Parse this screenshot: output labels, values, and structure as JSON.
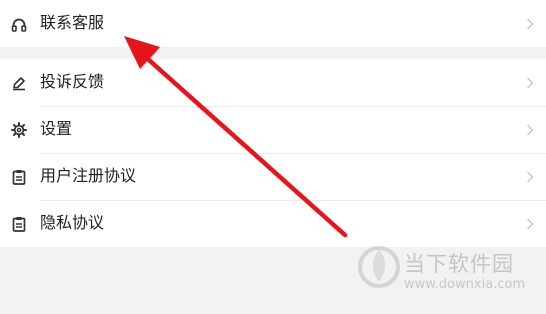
{
  "menu": {
    "top_items": [
      {
        "label": "联系客服",
        "icon": "headset-icon"
      }
    ],
    "items": [
      {
        "label": "投诉反馈",
        "icon": "edit-icon"
      },
      {
        "label": "设置",
        "icon": "gear-icon"
      },
      {
        "label": "用户注册协议",
        "icon": "clipboard-icon"
      },
      {
        "label": "隐私协议",
        "icon": "clipboard-icon"
      }
    ]
  },
  "annotation": {
    "color": "#e8141b"
  },
  "watermark": {
    "title": "当下软件园",
    "url": "www.downxia.com"
  }
}
